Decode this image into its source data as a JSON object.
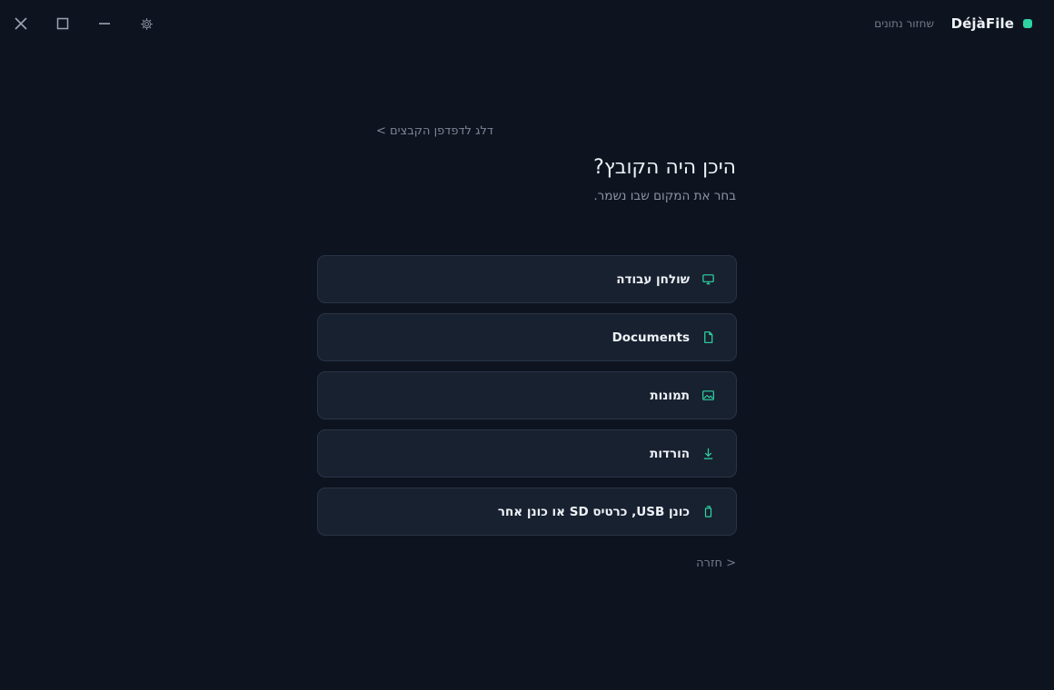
{
  "window": {
    "close_icon": "close-icon",
    "maximize_icon": "maximize-icon",
    "minimize_icon": "minimize-icon",
    "settings_icon": "gear-icon"
  },
  "header": {
    "app_name": "DéjàFile",
    "restore_link": "שחזור נתונים",
    "status_color": "#2fd4a4"
  },
  "main": {
    "skip_link": "דלג לדפדפן הקבצים >",
    "title": "היכן היה הקובץ?",
    "subtitle": "בחר את המקום שבו נשמר.",
    "locations": [
      {
        "label": "שולחן עבודה",
        "icon": "monitor-icon"
      },
      {
        "label": "Documents",
        "icon": "document-icon"
      },
      {
        "label": "תמונות",
        "icon": "image-icon"
      },
      {
        "label": "הורדות",
        "icon": "download-icon"
      },
      {
        "label": "כונן USB, כרטיס SD או כונן אחר",
        "icon": "usb-drive-icon"
      }
    ],
    "back_link": "< חזרה"
  },
  "colors": {
    "background": "#0e141f",
    "card": "#182130",
    "accent": "#2fd4a4"
  }
}
